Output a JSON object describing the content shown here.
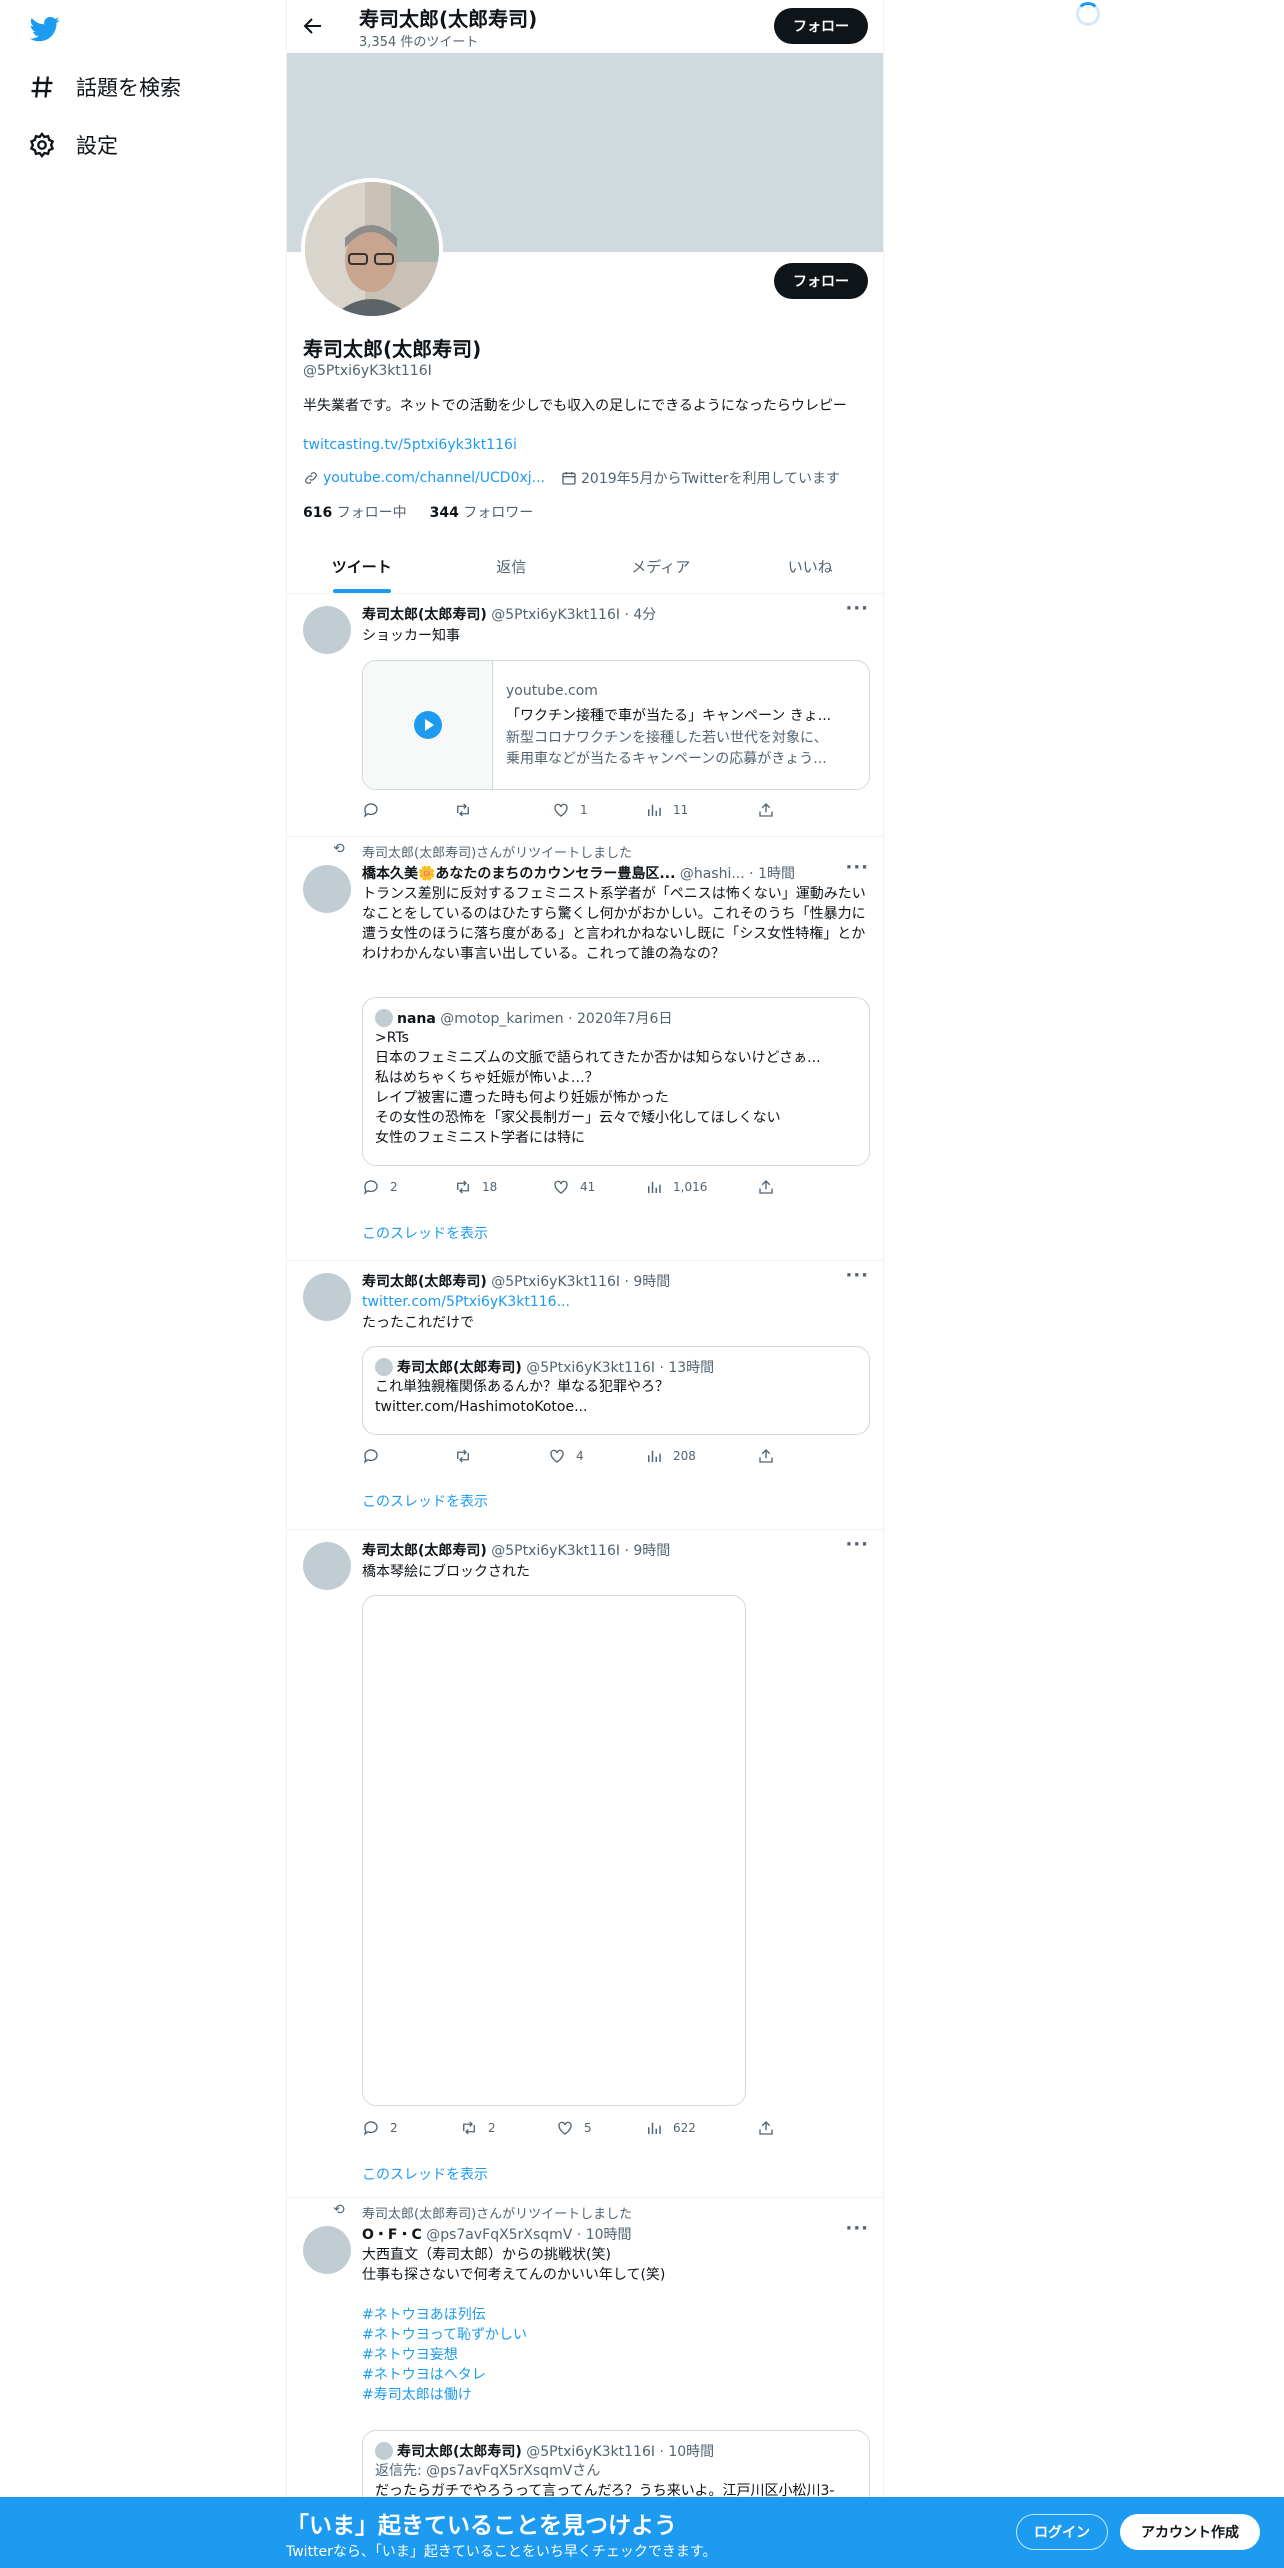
{
  "nav": {
    "items": [
      {
        "label": "話題を検索",
        "icon": "hashtag-icon"
      },
      {
        "label": "設定",
        "icon": "gear-icon"
      }
    ]
  },
  "topbar": {
    "name": "寿司太郎(太郎寿司)",
    "count": "3,354 件のツイート",
    "follow": "フォロー"
  },
  "profile": {
    "name": "寿司太郎(太郎寿司)",
    "handle": "@5Ptxi6yK3kt116I",
    "follow": "フォロー",
    "bio": "半失業者です。ネットでの活動を少しでも収入の足しにできるようになったらウレピー",
    "bio_link": "twitcasting.tv/5ptxi6yk3kt116i",
    "website": "youtube.com/channel/UCD0xj...",
    "joined": "2019年5月からTwitterを利用しています",
    "following_count": "616",
    "following_label": "フォロー中",
    "followers_count": "344",
    "followers_label": "フォロワー"
  },
  "tabs": [
    "ツイート",
    "返信",
    "メディア",
    "いいね"
  ],
  "tweets": [
    {
      "name": "寿司太郎(太郎寿司)",
      "handle": "@5Ptxi6yK3kt116I",
      "time": "4分",
      "text": "ショッカー知事",
      "card": {
        "domain": "youtube.com",
        "title": "「ワクチン接種で車が当たる」キャンペーン きょ...",
        "desc1": "新型コロナワクチンを接種した若い世代を対象に、",
        "desc2": "乗用車などが当たるキャンペーンの応募がきょう..."
      },
      "replies": "",
      "retweets": "",
      "likes": "1",
      "views": "11"
    },
    {
      "retweeted_by": "寿司太郎(太郎寿司)さんがリツイートしました",
      "name": "橋本久美🌼あなたのまちのカウンセラー豊島区...",
      "handle": "@hashi...",
      "time": "1時間",
      "text": "トランス差別に反対するフェミニスト系学者が「ペニスは怖くない」運動みたいなことをしているのはひたすら驚くし何かがおかしい。これそのうち「性暴力に遭う女性のほうに落ち度がある」と言われかねないし既に「シス女性特権」とかわけわかんない事言い出している。これって誰の為なの？",
      "quote": {
        "name": "nana",
        "handle": "@motop_karimen",
        "time": "2020年7月6日",
        "lines": [
          ">RTs",
          "日本のフェミニズムの文脈で語られてきたか否かは知らないけどさぁ...",
          "私はめちゃくちゃ妊娠が怖いよ…？",
          "レイプ被害に遭った時も何より妊娠が怖かった",
          "その女性の恐怖を「家父長制ガー」云々で矮小化してほしくない",
          "女性のフェミニスト学者には特に"
        ]
      },
      "replies": "2",
      "retweets": "18",
      "likes": "41",
      "views": "1,016",
      "thread": "このスレッドを表示"
    },
    {
      "name": "寿司太郎(太郎寿司)",
      "handle": "@5Ptxi6yK3kt116I",
      "time": "9時間",
      "link": "twitter.com/5Ptxi6yK3kt116...",
      "text": "たったこれだけで",
      "quote": {
        "name": "寿司太郎(太郎寿司)",
        "handle": "@5Ptxi6yK3kt116I",
        "time": "13時間",
        "lines": [
          "これ単独親権関係あるんか？単なる犯罪やろ？",
          "twitter.com/HashimotoKotoe..."
        ]
      },
      "replies": "",
      "retweets": "",
      "likes": "4",
      "views": "208",
      "thread": "このスレッドを表示"
    },
    {
      "name": "寿司太郎(太郎寿司)",
      "handle": "@5Ptxi6yK3kt116I",
      "time": "9時間",
      "text": "橋本琴絵にブロックされた",
      "replies": "2",
      "retweets": "2",
      "likes": "5",
      "views": "622",
      "thread": "このスレッドを表示"
    },
    {
      "retweeted_by": "寿司太郎(太郎寿司)さんがリツイートしました",
      "name": "O・F・C",
      "handle": "@ps7avFqX5rXsqmV",
      "time": "10時間",
      "text1": "大西直文（寿司太郎）からの挑戦状(笑)",
      "text2": "仕事も探さないで何考えてんのかいい年して(笑)",
      "hashtags": [
        "#ネトウヨあほ列伝",
        "#ネトウヨって恥ずかしい",
        "#ネトウヨ妄想",
        "#ネトウヨはヘタレ",
        "#寿司太郎は働け"
      ],
      "quote": {
        "name": "寿司太郎(太郎寿司)",
        "handle": "@5Ptxi6yK3kt116I",
        "time": "10時間",
        "reply_to": "返信先: @ps7avFqX5rXsqmVさん",
        "line": "だったらガチでやろうって言ってんだろ？うち来いよ。江戸川区小松川3-"
      }
    }
  ],
  "bottombar": {
    "title": "「いま」起きていることを見つけよう",
    "subtitle": "Twitterなら、「いま」起きていることをいち早くチェックできます。",
    "login": "ログイン",
    "signup": "アカウント作成"
  },
  "colors": {
    "accent": "#1d9bf0",
    "text": "#0f1419",
    "muted": "#536471",
    "banner": "#cfd9de"
  }
}
